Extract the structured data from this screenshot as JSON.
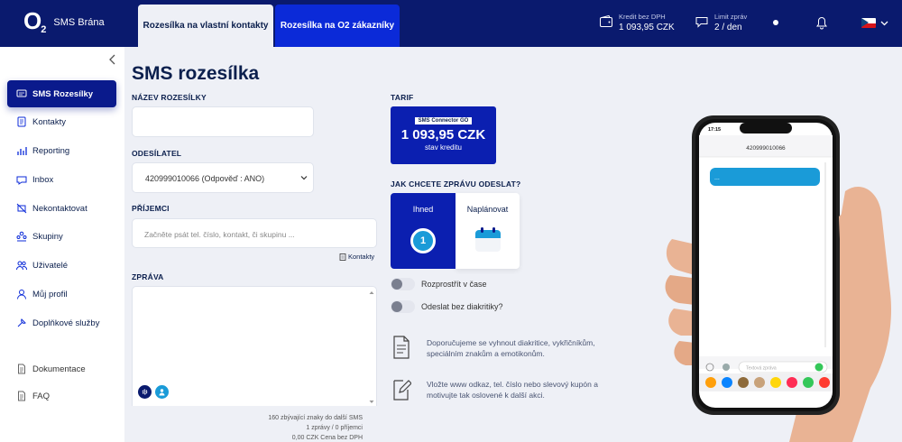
{
  "brand": {
    "logo_o": "O",
    "logo_two": "2",
    "name": "SMS Brána"
  },
  "tabs": [
    {
      "label": "Rozesílka na vlastní kontakty"
    },
    {
      "label": "Rozesílka na O2 zákazníky"
    }
  ],
  "topbar": {
    "credit_label": "Kredit bez DPH",
    "credit_value": "1 093,95 CZK",
    "limit_label": "Limit zpráv",
    "limit_value": "2 / den"
  },
  "sidebar": {
    "items": [
      {
        "label": "SMS Rozesílky",
        "icon": "sms-icon"
      },
      {
        "label": "Kontakty",
        "icon": "contacts-icon"
      },
      {
        "label": "Reporting",
        "icon": "chart-icon"
      },
      {
        "label": "Inbox",
        "icon": "inbox-icon"
      },
      {
        "label": "Nekontaktovat",
        "icon": "block-icon"
      },
      {
        "label": "Skupiny",
        "icon": "groups-icon"
      },
      {
        "label": "Uživatelé",
        "icon": "users-icon"
      },
      {
        "label": "Můj profil",
        "icon": "profile-icon"
      },
      {
        "label": "Doplňkové služby",
        "icon": "services-icon"
      }
    ],
    "secondary": [
      {
        "label": "Dokumentace",
        "icon": "document-icon"
      },
      {
        "label": "FAQ",
        "icon": "faq-icon"
      }
    ]
  },
  "page": {
    "title": "SMS rozesílka"
  },
  "form": {
    "name_label": "NÁZEV ROZESÍLKY",
    "name_value": "",
    "sender_label": "ODESÍLATEL",
    "sender_value": "420999010066 (Odpověď : ANO)",
    "recipients_label": "PŘÍJEMCI",
    "recipients_placeholder": "Začněte psát tel. číslo, kontakt, či skupinu ...",
    "contacts_link": "Kontakty",
    "message_label": "ZPRÁVA",
    "message_value": "",
    "footer_chars": "160 zbývající znaky do další SMS",
    "footer_counts": "1 zprávy / 0 příjemci",
    "footer_price": "0,00 CZK Cena bez DPH"
  },
  "tariff": {
    "label": "TARIF",
    "badge": "SMS Connector GO",
    "amount": "1 093,95 CZK",
    "sub": "stav kreditu"
  },
  "send": {
    "label": "JAK CHCETE ZPRÁVU ODESLAT?",
    "now_label": "Ihned",
    "now_number": "1",
    "later_label": "Naplánovat"
  },
  "toggles": [
    {
      "label": "Rozprostřít v čase",
      "on": false
    },
    {
      "label": "Odeslat bez diakritiky?",
      "on": false
    }
  ],
  "tips": [
    {
      "text": "Doporučujeme se vyhnout diakritice, vykřičníkům, speciálním znakům a emotikonům.",
      "icon": "document-icon"
    },
    {
      "text": "Vložte www odkaz, tel. číslo nebo slevový kupón a motivujte tak oslovené k další akci.",
      "icon": "edit-icon"
    }
  ],
  "phone": {
    "time": "17:15",
    "sender": "420999010066",
    "bubble": "...",
    "input_placeholder": "Textová zpráva"
  },
  "colors": {
    "navy": "#0a1a6e",
    "accent": "#0b2ad8",
    "tariff_blue": "#0b1fb0",
    "bubble": "#1a9bd8"
  }
}
